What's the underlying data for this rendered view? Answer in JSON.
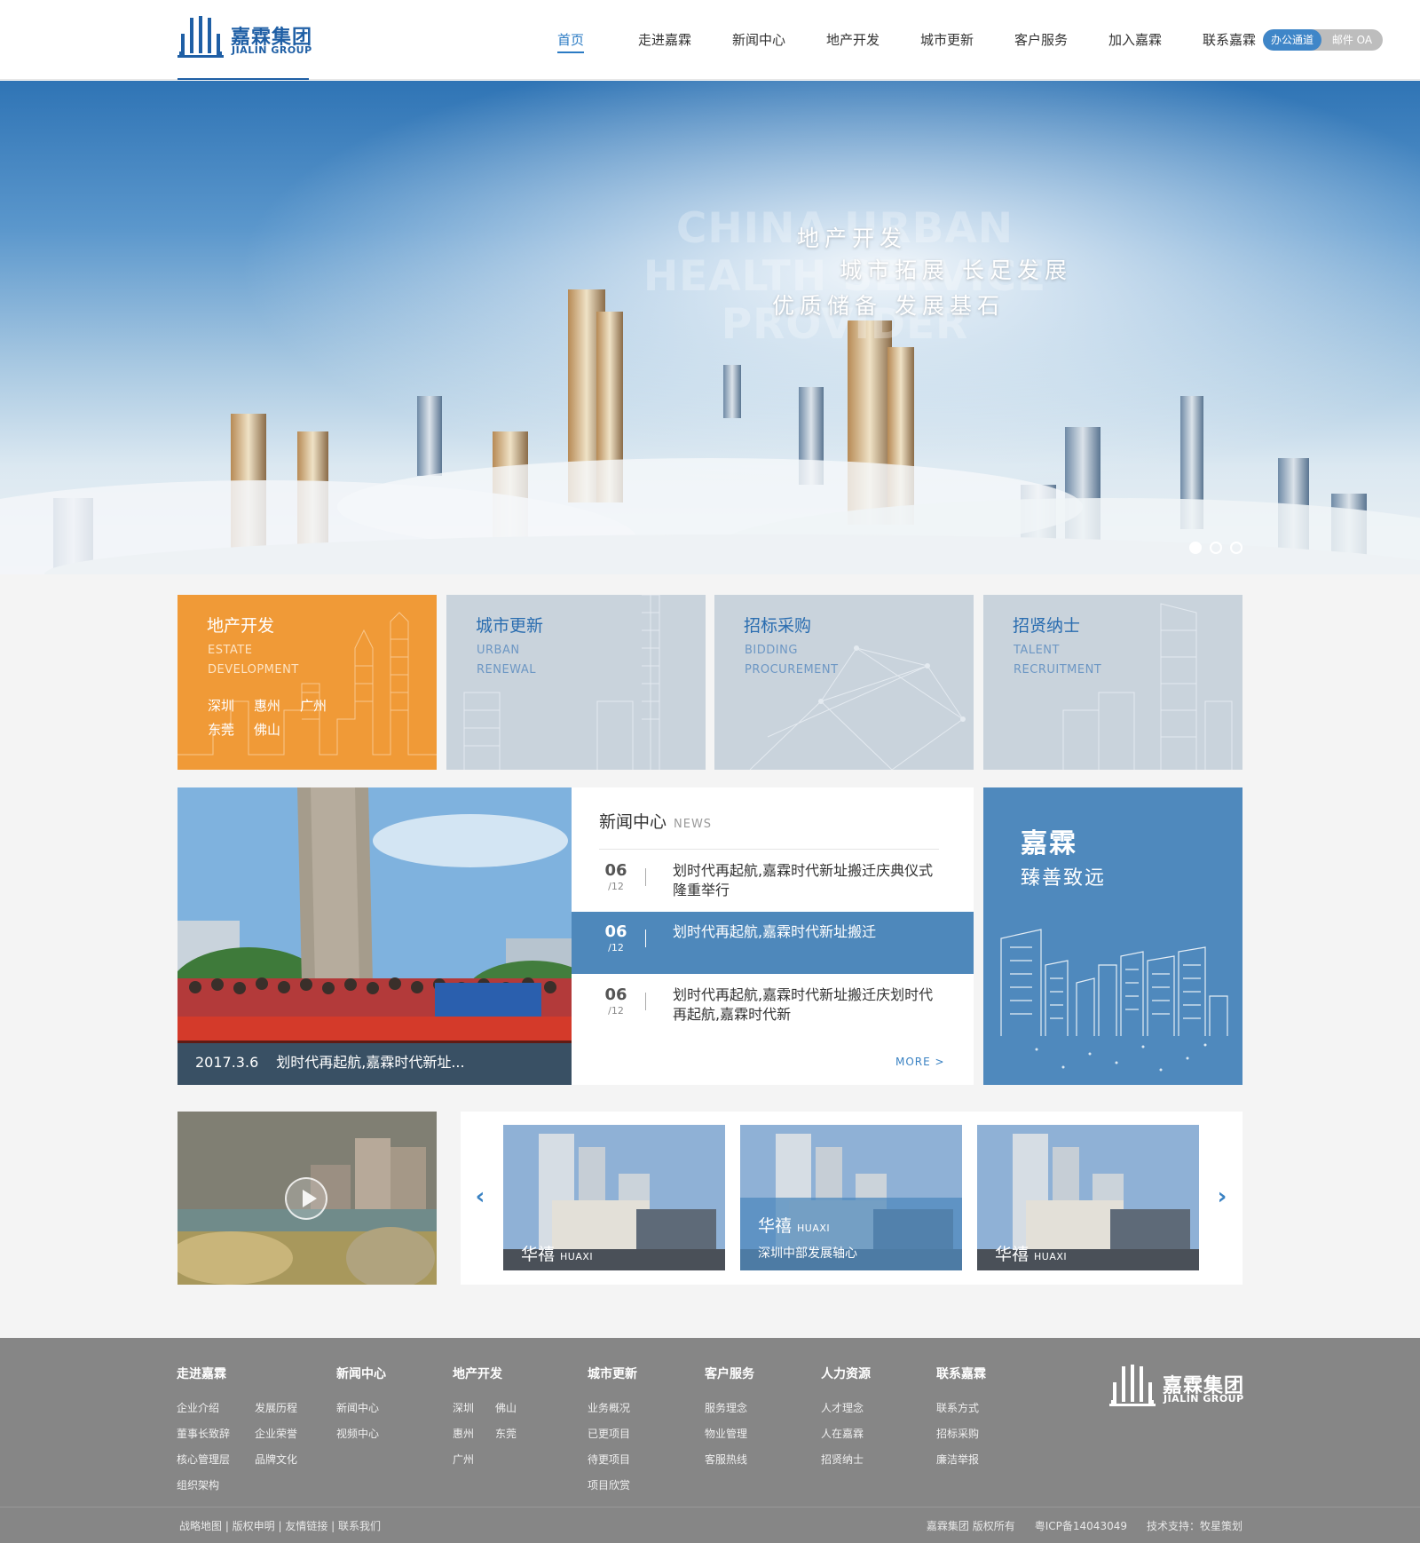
{
  "header": {
    "logo_cn": "嘉霖集团",
    "logo_en": "JIALIN GROUP",
    "nav": [
      "首页",
      "走进嘉霖",
      "新闻中心",
      "地产开发",
      "城市更新",
      "客户服务",
      "加入嘉霖",
      "联系嘉霖"
    ],
    "active_nav": "首页",
    "oa_primary": "办公通道",
    "oa_secondary": "邮件  OA"
  },
  "banner": {
    "en_text": "CHINA URBAN HEALTH SERVICE PROVIDER",
    "line1": "地产开发",
    "line2": "城市拓展 长足发展",
    "line3": "优质储备 发展基石",
    "slide_count": 3,
    "active_slide": 1
  },
  "cards": [
    {
      "title": "地产开发",
      "en1": "ESTATE",
      "en2": "DEVELOPMENT",
      "cities": [
        "深圳",
        "惠州",
        "广州",
        "东莞",
        "佛山"
      ]
    },
    {
      "title": "城市更新",
      "en1": "URBAN",
      "en2": "RENEWAL"
    },
    {
      "title": "招标采购",
      "en1": "BIDDING",
      "en2": "PROCUREMENT"
    },
    {
      "title": "招贤纳士",
      "en1": "TALENT",
      "en2": "RECRUITMENT"
    }
  ],
  "news": {
    "photo_date": "2017.3.6",
    "photo_caption": "划时代再起航,嘉霖时代新址...",
    "title": "新闻中心",
    "title_en": "NEWS",
    "items": [
      {
        "day": "06",
        "month": "12",
        "text": "划时代再起航,嘉霖时代新址搬迁庆典仪式隆重举行"
      },
      {
        "day": "06",
        "month": "12",
        "text": "划时代再起航,嘉霖时代新址搬迁"
      },
      {
        "day": "06",
        "month": "12",
        "text": "划时代再起航,嘉霖时代新址搬迁庆划时代再起航,嘉霖时代新"
      }
    ],
    "more": "MORE >"
  },
  "slogan": {
    "line1": "嘉霖",
    "line2": "臻善致远"
  },
  "projects": {
    "arrow_prev": "‹",
    "arrow_next": "›",
    "items": [
      {
        "name": "华禧",
        "en": "HUAXI"
      },
      {
        "name": "华禧",
        "en": "HUAXI",
        "subtitle": "深圳中部发展轴心"
      },
      {
        "name": "华禧",
        "en": "HUAXI"
      }
    ]
  },
  "footer": {
    "columns": [
      {
        "title": "走进嘉霖",
        "items": [
          "企业介绍",
          "发展历程",
          "董事长致辞",
          "企业荣誉",
          "核心管理层",
          "品牌文化",
          "组织架构"
        ]
      },
      {
        "title": "新闻中心",
        "items": [
          "新闻中心",
          "视频中心"
        ]
      },
      {
        "title": "地产开发",
        "items": [
          "深圳",
          "佛山",
          "惠州",
          "东莞",
          "广州"
        ]
      },
      {
        "title": "城市更新",
        "items": [
          "业务概况",
          "已更项目",
          "待更项目",
          "项目欣赏"
        ]
      },
      {
        "title": "客户服务",
        "items": [
          "服务理念",
          "物业管理",
          "客服热线"
        ]
      },
      {
        "title": "人力资源",
        "items": [
          "人才理念",
          "人在嘉霖",
          "招贤纳士"
        ]
      },
      {
        "title": "联系嘉霖",
        "items": [
          "联系方式",
          "招标采购",
          "廉洁举报"
        ]
      }
    ],
    "links": "战略地图 | 版权申明 | 友情链接 | 联系我们",
    "copyright": "嘉霖集团 版权所有",
    "icp": "粤ICP备14043049",
    "support": "技术支持：牧星策划"
  },
  "colors": {
    "brand": "#1f5fa5",
    "accent_orange": "#f09a37",
    "accent_blue": "#4f89bd",
    "footer_bg": "#868686"
  }
}
